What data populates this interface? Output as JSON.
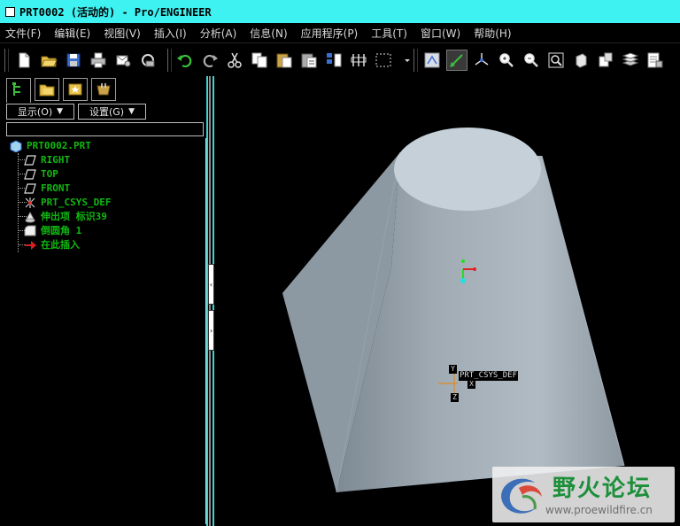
{
  "window": {
    "title": "PRT0002 (活动的) - Pro/ENGINEER"
  },
  "menu": {
    "items": [
      {
        "label": "文件(F)"
      },
      {
        "label": "编辑(E)"
      },
      {
        "label": "视图(V)"
      },
      {
        "label": "插入(I)"
      },
      {
        "label": "分析(A)"
      },
      {
        "label": "信息(N)"
      },
      {
        "label": "应用程序(P)"
      },
      {
        "label": "工具(T)"
      },
      {
        "label": "窗口(W)"
      },
      {
        "label": "帮助(H)"
      }
    ]
  },
  "toolbar": {
    "icons": [
      "new-icon",
      "open-icon",
      "save-icon",
      "print-icon",
      "send-email-icon",
      "regenerate-icon",
      "undo-icon",
      "redo-icon",
      "cut-icon",
      "copy-icon",
      "paste-icon",
      "paste-special-icon",
      "relations-icon",
      "regen-manager-icon",
      "select-box-icon",
      "select-mode-dropdown-icon",
      "spin-center-icon",
      "datum-display-icon",
      "csys-display-icon",
      "zoom-in-icon",
      "zoom-out-icon",
      "refit-icon",
      "shade-icon",
      "saved-views-icon",
      "layers-icon",
      "model-tree-settings-icon"
    ],
    "active_icon": "datum-display-icon"
  },
  "navigator": {
    "tabs": [
      {
        "name": "model-tree-tab",
        "icon": "model-tree-icon"
      },
      {
        "name": "folder-browser-tab",
        "icon": "folder-icon"
      },
      {
        "name": "favorites-tab",
        "icon": "favorites-icon"
      },
      {
        "name": "connections-tab",
        "icon": "connections-icon"
      }
    ],
    "show_label": "显示(O)",
    "settings_label": "设置(G)",
    "tree": [
      {
        "label": "PRT0002.PRT",
        "icon": "part-icon"
      },
      {
        "label": "RIGHT",
        "icon": "datum-plane-icon"
      },
      {
        "label": "TOP",
        "icon": "datum-plane-icon"
      },
      {
        "label": "FRONT",
        "icon": "datum-plane-icon"
      },
      {
        "label": "PRT_CSYS_DEF",
        "icon": "csys-icon"
      },
      {
        "label": "伸出项 标识39",
        "icon": "protrusion-icon"
      },
      {
        "label": "倒圆角 1",
        "icon": "round-icon"
      },
      {
        "label": "在此插入",
        "icon": "insert-here-arrow-icon"
      }
    ]
  },
  "viewport": {
    "csys_label": "PRT_CSYS_DEF",
    "axis_labels": {
      "x": "X",
      "y": "Y",
      "z": "Z"
    },
    "colors": {
      "model": "#9aa7b1",
      "top_face": "#c5d0d8",
      "background": "#000000"
    }
  },
  "watermark": {
    "title": "野火论坛",
    "url": "www.proewildfire.cn"
  },
  "colors": {
    "titlebar": "#3ff2f2",
    "tree_text": "#11b811"
  }
}
